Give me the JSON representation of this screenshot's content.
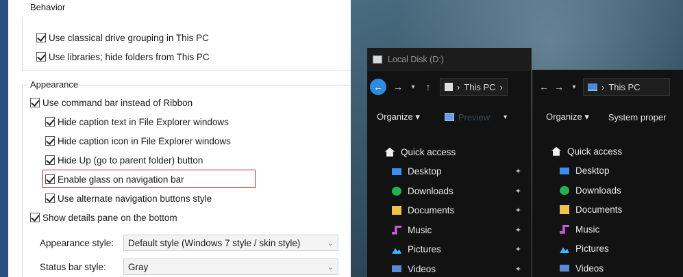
{
  "settings": {
    "behavior": {
      "title": "Behavior",
      "options": [
        {
          "label": "Use classical drive grouping in This PC",
          "checked": true
        },
        {
          "label": "Use libraries; hide folders from This PC",
          "checked": true
        }
      ]
    },
    "appearance": {
      "title": "Appearance",
      "options": [
        {
          "label": "Use command bar instead of Ribbon",
          "checked": true
        },
        {
          "label": "Hide caption text in File Explorer windows",
          "checked": true
        },
        {
          "label": "Hide caption icon in File Explorer windows",
          "checked": true
        },
        {
          "label": "Hide Up (go to parent folder) button",
          "checked": true
        },
        {
          "label": "Enable glass on navigation bar",
          "checked": true
        },
        {
          "label": "Use alternate navigation buttons style",
          "checked": true
        },
        {
          "label": "Show details pane on the bottom",
          "checked": true
        }
      ],
      "appearance_style": {
        "label": "Appearance style:",
        "value": "Default style (Windows 7 style / skin style)"
      },
      "status_bar_style": {
        "label": "Status bar style:",
        "value": "Gray"
      }
    },
    "highlight_color": "#b8282a"
  },
  "explorer1": {
    "title": "Local Disk (D:)",
    "breadcrumb": "This PC",
    "organize": "Organize",
    "pane_label": "Preview",
    "quick_access": "Quick access",
    "items": [
      "Desktop",
      "Downloads",
      "Documents",
      "Music",
      "Pictures",
      "Videos"
    ]
  },
  "explorer2": {
    "breadcrumb": "This PC",
    "organize": "Organize",
    "system_properties": "System proper",
    "quick_access": "Quick access",
    "items": [
      "Desktop",
      "Downloads",
      "Documents",
      "Music",
      "Pictures",
      "Videos"
    ]
  },
  "icons": {
    "back": "arrow-left-icon",
    "forward": "arrow-right-icon",
    "up": "arrow-up-icon",
    "pin": "pin-icon"
  },
  "colors": {
    "accent_blue": "#2d8ae0",
    "explorer_bg": "#121212"
  }
}
